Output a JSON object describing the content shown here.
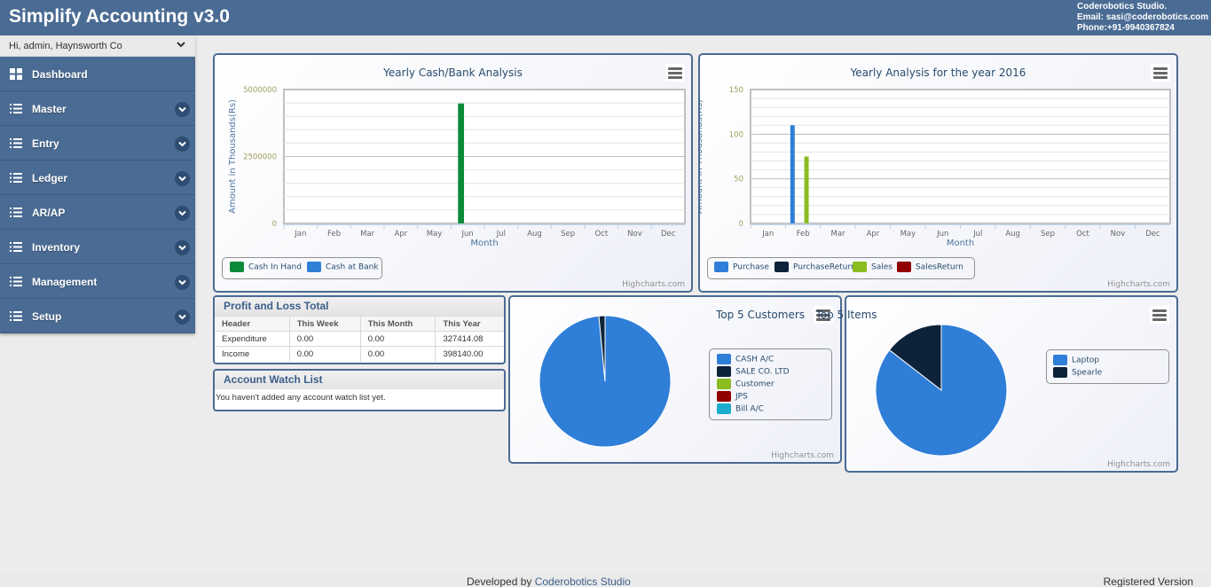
{
  "header": {
    "title": "Simplify Accounting v3.0",
    "company": "Coderobotics Studio.",
    "email": "Email: sasi@coderobotics.com",
    "phone": "Phone:+91-9940367824"
  },
  "sidebar": {
    "user_label": "Hi, admin, Haynsworth Co",
    "items": [
      {
        "label": "Dashboard",
        "icon": "grid-icon",
        "expandable": false
      },
      {
        "label": "Master",
        "icon": "list-icon",
        "expandable": true
      },
      {
        "label": "Entry",
        "icon": "list-icon",
        "expandable": true
      },
      {
        "label": "Ledger",
        "icon": "list-icon",
        "expandable": true
      },
      {
        "label": "AR/AP",
        "icon": "list-icon",
        "expandable": true
      },
      {
        "label": "Inventory",
        "icon": "list-icon",
        "expandable": true
      },
      {
        "label": "Management",
        "icon": "list-icon",
        "expandable": true
      },
      {
        "label": "Setup",
        "icon": "list-icon",
        "expandable": true
      }
    ]
  },
  "colors": {
    "brand": "#4a6b93",
    "cash_in_hand": "#0b8b3a",
    "cash_at_bank": "#2f7ed8",
    "purchase": "#2f7ed8",
    "purchase_return": "#0d233a",
    "sales": "#8bbc21",
    "sales_return": "#910000",
    "bill": "#1aadce"
  },
  "credit": "Highcharts.com",
  "chart_data": [
    {
      "id": "cash_bank",
      "type": "bar",
      "title": "Yearly Cash/Bank Analysis",
      "xlabel": "Month",
      "ylabel": "Amount in Thousands(Rs)",
      "categories": [
        "Jan",
        "Feb",
        "Mar",
        "Apr",
        "May",
        "Jun",
        "Jul",
        "Aug",
        "Sep",
        "Oct",
        "Nov",
        "Dec"
      ],
      "ylim": [
        0,
        5000000
      ],
      "yticks": [
        "0",
        "2500000",
        "5000000"
      ],
      "ytick_values": [
        0,
        2500000,
        5000000
      ],
      "minor_gridlines": 10,
      "grid": true,
      "legend_position": "bottom-left",
      "series": [
        {
          "name": "Cash In Hand",
          "color": "#0b8b3a",
          "values": [
            0,
            0,
            0,
            0,
            0,
            4480000,
            0,
            0,
            0,
            0,
            0,
            0
          ]
        },
        {
          "name": "Cash at Bank",
          "color": "#2f7ed8",
          "values": [
            0,
            0,
            0,
            0,
            0,
            0,
            0,
            0,
            0,
            0,
            0,
            0
          ]
        }
      ]
    },
    {
      "id": "yearly_2016",
      "type": "bar",
      "title": "Yearly Analysis for the year 2016",
      "xlabel": "Month",
      "ylabel": "Amount in Thousands(Rs)",
      "categories": [
        "Jan",
        "Feb",
        "Mar",
        "Apr",
        "May",
        "Jun",
        "Jul",
        "Aug",
        "Sep",
        "Oct",
        "Nov",
        "Dec"
      ],
      "ylim": [
        0,
        150
      ],
      "yticks": [
        "0",
        "50",
        "100",
        "150"
      ],
      "ytick_values": [
        0,
        50,
        100,
        150
      ],
      "minor_gridlines": 15,
      "grid": true,
      "legend_position": "bottom-left",
      "series": [
        {
          "name": "Purchase",
          "color": "#2f7ed8",
          "values": [
            0,
            110,
            0,
            0,
            0,
            0,
            0,
            0,
            0,
            0,
            0,
            0
          ]
        },
        {
          "name": "PurchaseReturn",
          "color": "#0d233a",
          "values": [
            0,
            0,
            0,
            0,
            0,
            0,
            0,
            0,
            0,
            0,
            0,
            0
          ]
        },
        {
          "name": "Sales",
          "color": "#8bbc21",
          "values": [
            0,
            75,
            0,
            0,
            0,
            0,
            0,
            0,
            0,
            0,
            0,
            0
          ]
        },
        {
          "name": "SalesReturn",
          "color": "#910000",
          "values": [
            0,
            0,
            0,
            0,
            0,
            0,
            0,
            0,
            0,
            0,
            0,
            0
          ]
        }
      ]
    },
    {
      "id": "top_customers",
      "type": "pie",
      "title": "Top 5 Customers",
      "legend_position": "right",
      "slices": [
        {
          "name": "CASH A/C",
          "color": "#2f7ed8",
          "value": 98.5
        },
        {
          "name": "SALE CO. LTD",
          "color": "#0d233a",
          "value": 1.5
        },
        {
          "name": "Customer",
          "color": "#8bbc21",
          "value": 0
        },
        {
          "name": "JPS",
          "color": "#910000",
          "value": 0
        },
        {
          "name": "Bill A/C",
          "color": "#1aadce",
          "value": 0
        }
      ]
    },
    {
      "id": "top_items",
      "type": "pie",
      "title": "Top 5 Items",
      "legend_position": "right",
      "slices": [
        {
          "name": "Laptop",
          "color": "#2f7ed8",
          "value": 85.5
        },
        {
          "name": "Spearle",
          "color": "#0d233a",
          "value": 14.5
        }
      ]
    }
  ],
  "profit_loss": {
    "title": "Profit and Loss Total",
    "columns": [
      "Header",
      "This Week",
      "This Month",
      "This Year"
    ],
    "rows": [
      [
        "Expenditure",
        "0.00",
        "0.00",
        "327414.08"
      ],
      [
        "Income",
        "0.00",
        "0.00",
        "398140.00"
      ]
    ]
  },
  "watch_list": {
    "title": "Account Watch List",
    "message": "You haven't added any account watch list yet."
  },
  "footer": {
    "developed_by": "Developed by ",
    "link": "Coderobotics Studio",
    "version": "Registered Version"
  }
}
